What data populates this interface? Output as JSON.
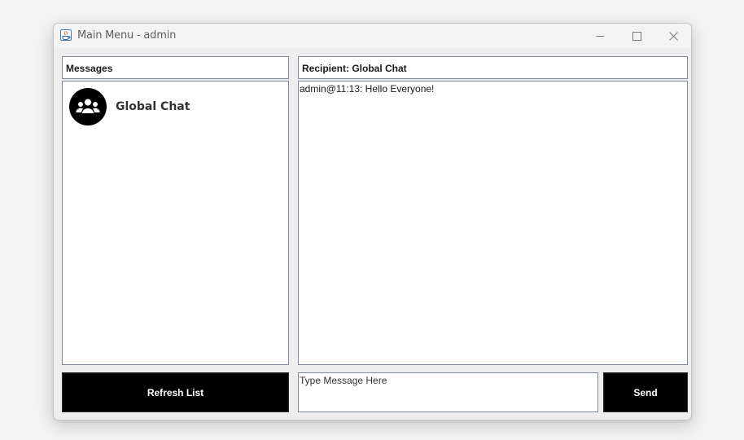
{
  "window": {
    "title": "Main Menu - admin"
  },
  "messages_panel": {
    "header": "Messages",
    "items": [
      {
        "label": "Global Chat",
        "icon": "group-icon"
      }
    ]
  },
  "chat_panel": {
    "header": "Recipient: Global Chat",
    "messages": [
      "admin@11:13: Hello Everyone!"
    ]
  },
  "footer": {
    "refresh_label": "Refresh List",
    "message_placeholder": "Type Message Here",
    "send_label": "Send"
  },
  "colors": {
    "button_bg": "#000000",
    "button_text": "#ffffff",
    "border": "#7f8a99"
  }
}
